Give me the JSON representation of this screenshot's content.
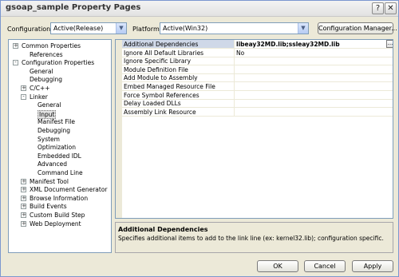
{
  "window": {
    "title": "gsoap_sample Property Pages",
    "help_glyph": "?",
    "close_glyph": "✕"
  },
  "config": {
    "configuration_label": "Configuration:",
    "configuration_value": "Active(Release)",
    "platform_label": "Platform:",
    "platform_value": "Active(Win32)",
    "manager_button": "Configuration Manager..."
  },
  "tree": [
    {
      "label": "Common Properties",
      "level": 0,
      "toggle": "+"
    },
    {
      "label": "References",
      "level": 1,
      "toggle": ""
    },
    {
      "label": "Configuration Properties",
      "level": 0,
      "toggle": "-"
    },
    {
      "label": "General",
      "level": 1,
      "toggle": ""
    },
    {
      "label": "Debugging",
      "level": 1,
      "toggle": ""
    },
    {
      "label": "C/C++",
      "level": 1,
      "toggle": "+"
    },
    {
      "label": "Linker",
      "level": 1,
      "toggle": "-"
    },
    {
      "label": "General",
      "level": 2,
      "toggle": ""
    },
    {
      "label": "Input",
      "level": 2,
      "toggle": "",
      "selected": true
    },
    {
      "label": "Manifest File",
      "level": 2,
      "toggle": ""
    },
    {
      "label": "Debugging",
      "level": 2,
      "toggle": ""
    },
    {
      "label": "System",
      "level": 2,
      "toggle": ""
    },
    {
      "label": "Optimization",
      "level": 2,
      "toggle": ""
    },
    {
      "label": "Embedded IDL",
      "level": 2,
      "toggle": ""
    },
    {
      "label": "Advanced",
      "level": 2,
      "toggle": ""
    },
    {
      "label": "Command Line",
      "level": 2,
      "toggle": ""
    },
    {
      "label": "Manifest Tool",
      "level": 1,
      "toggle": "+"
    },
    {
      "label": "XML Document Generator",
      "level": 1,
      "toggle": "+"
    },
    {
      "label": "Browse Information",
      "level": 1,
      "toggle": "+"
    },
    {
      "label": "Build Events",
      "level": 1,
      "toggle": "+"
    },
    {
      "label": "Custom Build Step",
      "level": 1,
      "toggle": "+"
    },
    {
      "label": "Web Deployment",
      "level": 1,
      "toggle": "+"
    }
  ],
  "properties": [
    {
      "name": "Additional Dependencies",
      "value": "libeay32MD.lib;ssleay32MD.lib",
      "selected": true,
      "ellipsis": "..."
    },
    {
      "name": "Ignore All Default Libraries",
      "value": "No"
    },
    {
      "name": "Ignore Specific Library",
      "value": ""
    },
    {
      "name": "Module Definition File",
      "value": ""
    },
    {
      "name": "Add Module to Assembly",
      "value": ""
    },
    {
      "name": "Embed Managed Resource File",
      "value": ""
    },
    {
      "name": "Force Symbol References",
      "value": ""
    },
    {
      "name": "Delay Loaded DLLs",
      "value": ""
    },
    {
      "name": "Assembly Link Resource",
      "value": ""
    }
  ],
  "description": {
    "title": "Additional Dependencies",
    "text": "Specifies additional items to add to the link line (ex: kernel32.lib); configuration specific."
  },
  "buttons": {
    "ok": "OK",
    "cancel": "Cancel",
    "apply": "Apply"
  }
}
